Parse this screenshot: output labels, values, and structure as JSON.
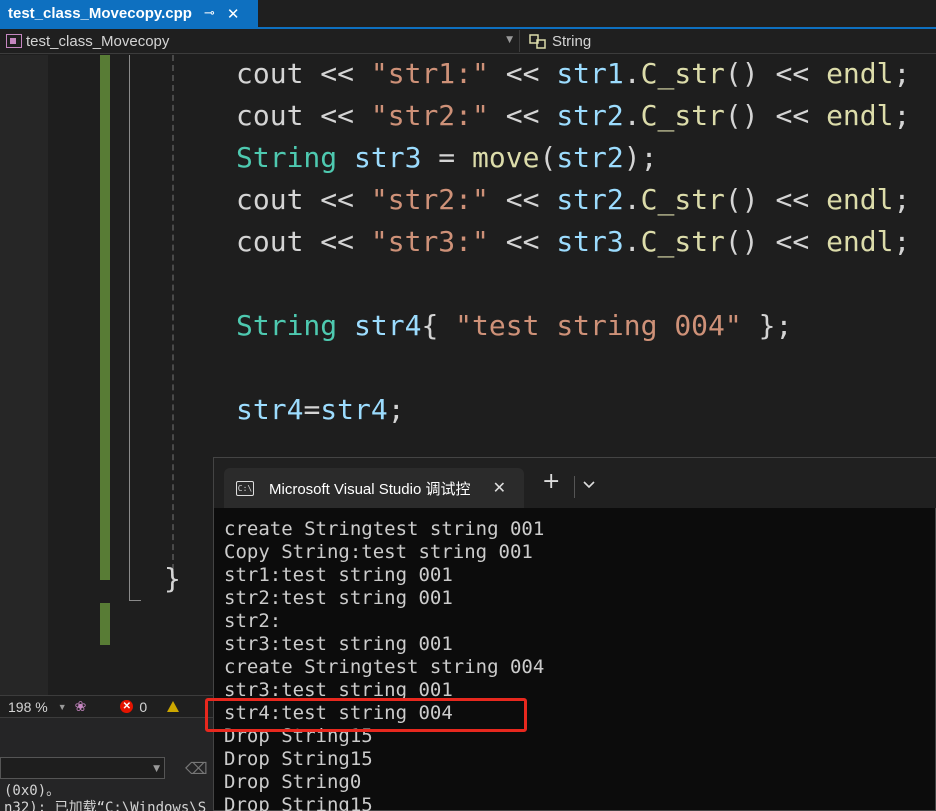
{
  "tab": {
    "filename": "test_class_Movecopy.cpp",
    "pin": "⊸",
    "close": "✕"
  },
  "navbar": {
    "scope": "test_class_Movecopy",
    "member": "String"
  },
  "code": {
    "lines": [
      [
        {
          "t": "cout",
          "c": "pl"
        },
        {
          "t": " << ",
          "c": "pl"
        },
        {
          "t": "\"str1:\"",
          "c": "st"
        },
        {
          "t": " << ",
          "c": "pl"
        },
        {
          "t": "str1",
          "c": "kw"
        },
        {
          "t": ".",
          "c": "pl"
        },
        {
          "t": "C_str",
          "c": "fn"
        },
        {
          "t": "() << ",
          "c": "pl"
        },
        {
          "t": "endl",
          "c": "fn"
        },
        {
          "t": ";",
          "c": "pl"
        }
      ],
      [
        {
          "t": "cout",
          "c": "pl"
        },
        {
          "t": " << ",
          "c": "pl"
        },
        {
          "t": "\"str2:\"",
          "c": "st"
        },
        {
          "t": " << ",
          "c": "pl"
        },
        {
          "t": "str2",
          "c": "kw"
        },
        {
          "t": ".",
          "c": "pl"
        },
        {
          "t": "C_str",
          "c": "fn"
        },
        {
          "t": "() << ",
          "c": "pl"
        },
        {
          "t": "endl",
          "c": "fn"
        },
        {
          "t": ";",
          "c": "pl"
        }
      ],
      [
        {
          "t": "String",
          "c": "ty"
        },
        {
          "t": " ",
          "c": "pl"
        },
        {
          "t": "str3",
          "c": "kw"
        },
        {
          "t": " = ",
          "c": "pl"
        },
        {
          "t": "move",
          "c": "fn"
        },
        {
          "t": "(",
          "c": "pl"
        },
        {
          "t": "str2",
          "c": "kw"
        },
        {
          "t": ");",
          "c": "pl"
        }
      ],
      [
        {
          "t": "cout",
          "c": "pl"
        },
        {
          "t": " << ",
          "c": "pl"
        },
        {
          "t": "\"str2:\"",
          "c": "st"
        },
        {
          "t": " << ",
          "c": "pl"
        },
        {
          "t": "str2",
          "c": "kw"
        },
        {
          "t": ".",
          "c": "pl"
        },
        {
          "t": "C_str",
          "c": "fn"
        },
        {
          "t": "() << ",
          "c": "pl"
        },
        {
          "t": "endl",
          "c": "fn"
        },
        {
          "t": ";",
          "c": "pl"
        }
      ],
      [
        {
          "t": "cout",
          "c": "pl"
        },
        {
          "t": " << ",
          "c": "pl"
        },
        {
          "t": "\"str3:\"",
          "c": "st"
        },
        {
          "t": " << ",
          "c": "pl"
        },
        {
          "t": "str3",
          "c": "kw"
        },
        {
          "t": ".",
          "c": "pl"
        },
        {
          "t": "C_str",
          "c": "fn"
        },
        {
          "t": "() << ",
          "c": "pl"
        },
        {
          "t": "endl",
          "c": "fn"
        },
        {
          "t": ";",
          "c": "pl"
        }
      ],
      [],
      [
        {
          "t": "String",
          "c": "ty"
        },
        {
          "t": " ",
          "c": "pl"
        },
        {
          "t": "str4",
          "c": "kw"
        },
        {
          "t": "{ ",
          "c": "pl"
        },
        {
          "t": "\"test string 004\"",
          "c": "st"
        },
        {
          "t": " };",
          "c": "pl"
        }
      ],
      [],
      [
        {
          "t": "str4",
          "c": "kw"
        },
        {
          "t": "=",
          "c": "pl"
        },
        {
          "t": "str4",
          "c": "kw"
        },
        {
          "t": ";",
          "c": "pl"
        }
      ]
    ],
    "closing_brace": "}"
  },
  "status": {
    "zoom": "198 %",
    "errors": "0",
    "error_icon": "✕"
  },
  "output": {
    "line1": "(0x0)。",
    "line2": "n32): 已加载“C:\\Windows\\S"
  },
  "console": {
    "title": "Microsoft Visual Studio 调试控",
    "icon_text": "C:\\",
    "close": "✕",
    "plus": "+",
    "lines": [
      "create Stringtest string 001",
      "Copy String:test string 001",
      "str1:test string 001",
      "str2:test string 001",
      "str2:",
      "str3:test string 001",
      "create Stringtest string 004",
      "str3:test string 001",
      "str4:test string 004",
      "Drop String15",
      "Drop String15",
      "Drop String0",
      "Drop String15"
    ]
  }
}
